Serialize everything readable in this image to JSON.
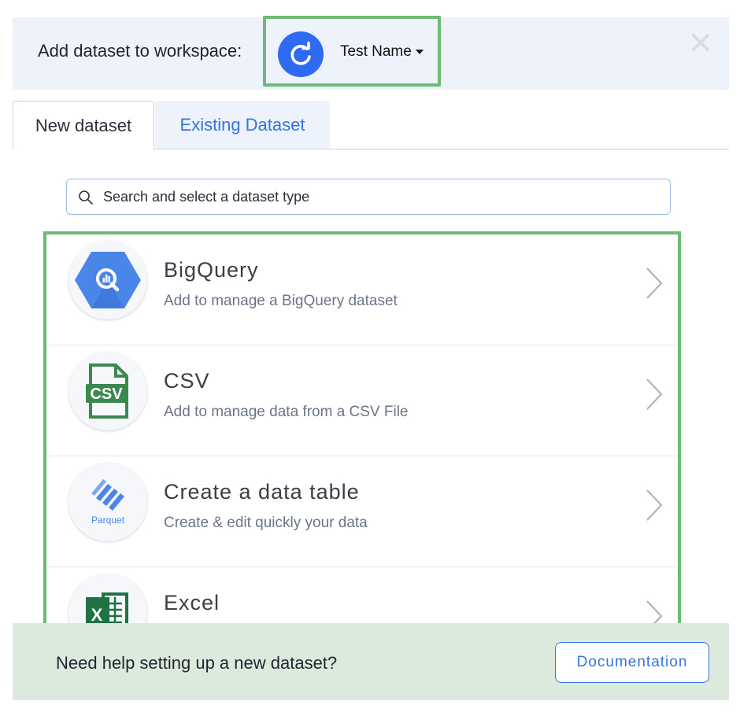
{
  "header": {
    "title": "Add dataset to workspace:",
    "workspace_name": "Test Name",
    "avatar_icon": "refresh-icon",
    "close_icon": "close-icon"
  },
  "tabs": [
    {
      "label": "New dataset",
      "active": true
    },
    {
      "label": "Existing Dataset",
      "active": false
    }
  ],
  "search": {
    "placeholder": "Search and select a dataset type",
    "value": ""
  },
  "datasets": [
    {
      "title": "BigQuery",
      "description": "Add to manage a BigQuery dataset",
      "icon": "bigquery-icon"
    },
    {
      "title": "CSV",
      "description": "Add to manage data from a CSV File",
      "icon": "csv-file-icon"
    },
    {
      "title": "Create a data table",
      "description": "Create & edit quickly your data",
      "icon": "parquet-icon",
      "icon_text": "Parquet"
    },
    {
      "title": "Excel",
      "description": "",
      "icon": "excel-icon"
    }
  ],
  "footer": {
    "text": "Need help setting up a new dataset?",
    "button_label": "Documentation"
  },
  "colors": {
    "accent": "#3474e0",
    "highlight_border": "#6cba74",
    "header_bg": "#eef3fb",
    "footer_bg": "#dbeadc",
    "bigquery": "#4a86e8",
    "csv": "#3a8a4e",
    "excel": "#1f7244"
  }
}
